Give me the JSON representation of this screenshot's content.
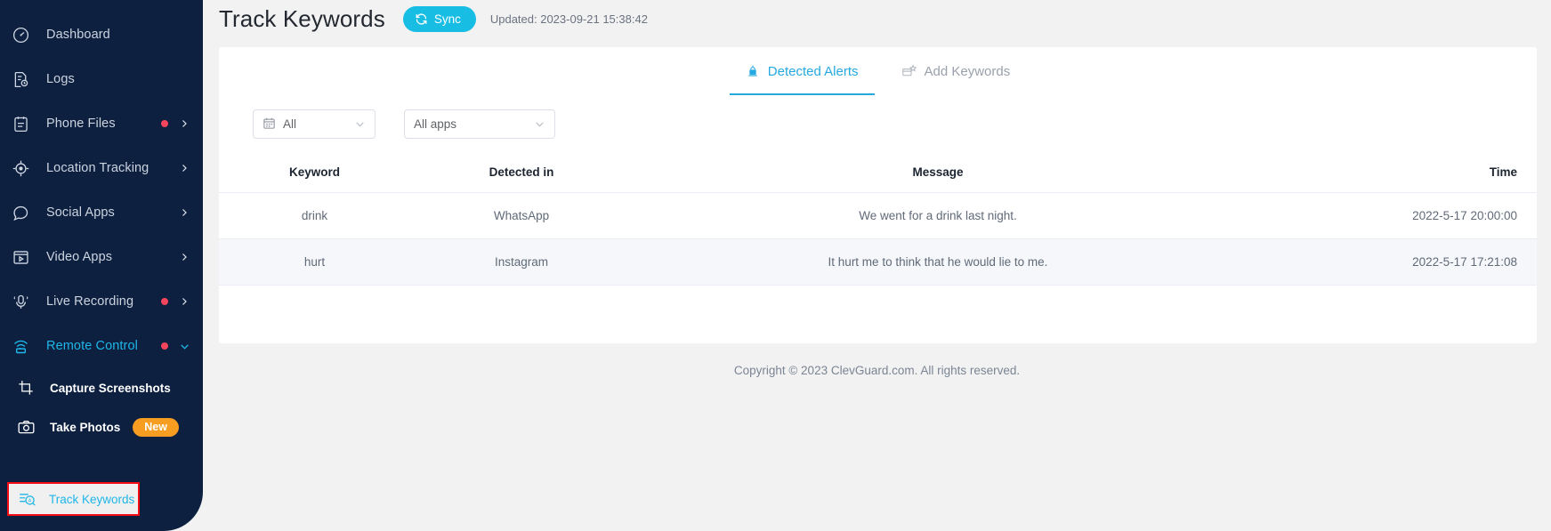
{
  "sidebar": {
    "items": [
      {
        "label": "Dashboard",
        "icon": "gauge-icon",
        "dot": false,
        "chevron": "none",
        "active": false
      },
      {
        "label": "Logs",
        "icon": "log-file-icon",
        "dot": false,
        "chevron": "none",
        "active": false
      },
      {
        "label": "Phone Files",
        "icon": "clipboard-icon",
        "dot": true,
        "chevron": "right",
        "active": false
      },
      {
        "label": "Location Tracking",
        "icon": "target-icon",
        "dot": false,
        "chevron": "right",
        "active": false
      },
      {
        "label": "Social Apps",
        "icon": "chat-bubble-icon",
        "dot": false,
        "chevron": "right",
        "active": false
      },
      {
        "label": "Video Apps",
        "icon": "video-player-icon",
        "dot": false,
        "chevron": "right",
        "active": false
      },
      {
        "label": "Live Recording",
        "icon": "microphone-icon",
        "dot": true,
        "chevron": "right",
        "active": false
      },
      {
        "label": "Remote Control",
        "icon": "wifi-device-icon",
        "dot": true,
        "chevron": "down",
        "active": true
      }
    ],
    "sub_items": [
      {
        "label": "Capture Screenshots",
        "icon": "crop-icon",
        "badge": "",
        "selected": false
      },
      {
        "label": "Take Photos",
        "icon": "camera-icon",
        "badge": "New",
        "selected": false
      },
      {
        "label": "Track Keywords",
        "icon": "keyword-scan-icon",
        "badge": "",
        "selected": true
      }
    ]
  },
  "header": {
    "title": "Track Keywords",
    "sync_label": "Sync",
    "sync_icon": "refresh-icon",
    "updated_text": "Updated: 2023-09-21 15:38:42"
  },
  "tabs": [
    {
      "label": "Detected Alerts",
      "icon": "alarm-icon",
      "active": true
    },
    {
      "label": "Add Keywords",
      "icon": "add-keyword-icon",
      "active": false
    }
  ],
  "filters": {
    "date": {
      "value": "All",
      "icon": "calendar-icon"
    },
    "app": {
      "value": "All apps",
      "icon": ""
    }
  },
  "table": {
    "columns": [
      "Keyword",
      "Detected in",
      "Message",
      "Time"
    ],
    "rows": [
      {
        "keyword": "drink",
        "detected_in": "WhatsApp",
        "message": "We went for a drink last night.",
        "time": "2022-5-17 20:00:00"
      },
      {
        "keyword": "hurt",
        "detected_in": "Instagram",
        "message": "It hurt me to think that he would lie to me.",
        "time": "2022-5-17 17:21:08"
      }
    ]
  },
  "footer": {
    "copyright": "Copyright © 2023 ClevGuard.com. All rights reserved."
  },
  "colors": {
    "sidebar_bg": "#0d2040",
    "accent": "#1fb6e8",
    "sync_bg": "#18bde4",
    "badge": "#f79d21",
    "dot": "#f5455c",
    "highlight_border": "#f40d14"
  }
}
